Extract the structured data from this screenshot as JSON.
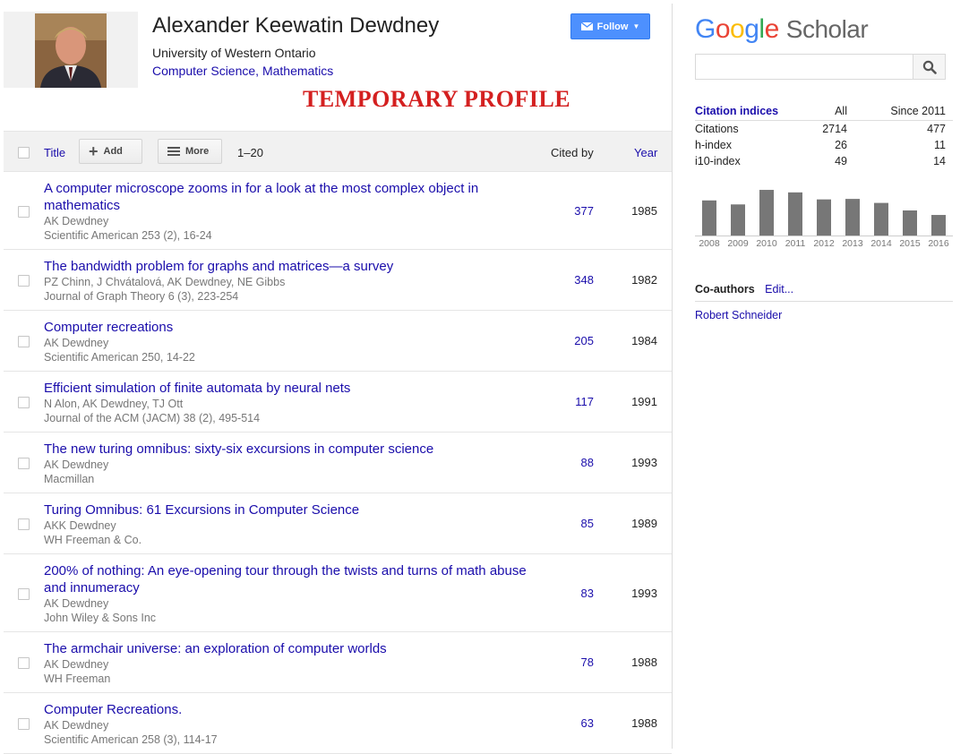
{
  "profile": {
    "name": "Alexander Keewatin Dewdney",
    "affiliation": "University of Western Ontario",
    "interests": "Computer Science, Mathematics",
    "banner": "TEMPORARY PROFILE",
    "follow_label": "Follow"
  },
  "toolbar": {
    "title_label": "Title",
    "add_label": "Add",
    "more_label": "More",
    "range": "1–20",
    "cited_by_label": "Cited by",
    "year_label": "Year"
  },
  "articles": [
    {
      "title": "A computer microscope zooms in for a look at the most complex object in mathematics",
      "authors": "AK Dewdney",
      "venue": "Scientific American 253 (2), 16-24",
      "cited": "377",
      "year": "1985"
    },
    {
      "title": "The bandwidth problem for graphs and matrices—a survey",
      "authors": "PZ Chinn, J Chvátalová, AK Dewdney, NE Gibbs",
      "venue": "Journal of Graph Theory 6 (3), 223-254",
      "cited": "348",
      "year": "1982"
    },
    {
      "title": "Computer recreations",
      "authors": "AK Dewdney",
      "venue": "Scientific American 250, 14-22",
      "cited": "205",
      "year": "1984"
    },
    {
      "title": "Efficient simulation of finite automata by neural nets",
      "authors": "N Alon, AK Dewdney, TJ Ott",
      "venue": "Journal of the ACM (JACM) 38 (2), 495-514",
      "cited": "117",
      "year": "1991"
    },
    {
      "title": "The new turing omnibus: sixty-six excursions in computer science",
      "authors": "AK Dewdney",
      "venue": "Macmillan",
      "cited": "88",
      "year": "1993"
    },
    {
      "title": "Turing Omnibus: 61 Excursions in Computer Science",
      "authors": "AKK Dewdney",
      "venue": "WH Freeman & Co.",
      "cited": "85",
      "year": "1989"
    },
    {
      "title": "200% of nothing: An eye-opening tour through the twists and turns of math abuse and innumeracy",
      "authors": "AK Dewdney",
      "venue": "John Wiley & Sons Inc",
      "cited": "83",
      "year": "1993"
    },
    {
      "title": "The armchair universe: an exploration of computer worlds",
      "authors": "AK Dewdney",
      "venue": "WH Freeman",
      "cited": "78",
      "year": "1988"
    },
    {
      "title": "Computer Recreations.",
      "authors": "AK Dewdney",
      "venue": "Scientific American 258 (3), 114-17",
      "cited": "63",
      "year": "1988"
    }
  ],
  "sidebar": {
    "logo_google": [
      "G",
      "o",
      "o",
      "g",
      "l",
      "e"
    ],
    "logo_scholar": "Scholar",
    "search_value": "",
    "citation_indices": {
      "heading": "Citation indices",
      "col_all": "All",
      "col_since": "Since 2011",
      "rows": [
        {
          "label": "Citations",
          "all": "2714",
          "since": "477"
        },
        {
          "label": "h-index",
          "all": "26",
          "since": "11"
        },
        {
          "label": "i10-index",
          "all": "49",
          "since": "14"
        }
      ]
    },
    "coauthors": {
      "heading": "Co-authors",
      "edit_label": "Edit...",
      "items": [
        "Robert Schneider"
      ]
    }
  },
  "colors": {
    "link": "#1a0dab",
    "banner_red": "#d42020",
    "follow_blue": "#4d90fe",
    "bar_gray": "#777777"
  },
  "icons": [
    "envelope-icon",
    "chevron-down-icon",
    "plus-icon",
    "menu-icon",
    "search-icon",
    "checkbox-icon"
  ],
  "chart_data": {
    "type": "bar",
    "categories": [
      "2008",
      "2009",
      "2010",
      "2011",
      "2012",
      "2013",
      "2014",
      "2015",
      "2016"
    ],
    "values": [
      70,
      62,
      91,
      86,
      72,
      73,
      65,
      50,
      41
    ],
    "ylim": [
      0,
      100
    ],
    "grid": false
  }
}
